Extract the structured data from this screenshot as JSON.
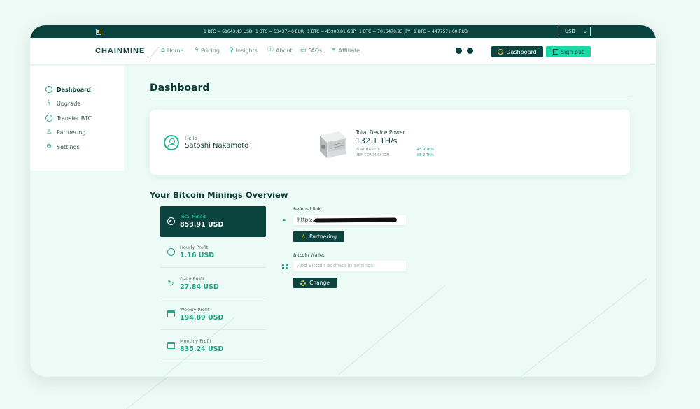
{
  "ticker": {
    "rates": [
      "1 BTC = 61643.43 USD",
      "1 BTC = 53437.46 EUR",
      "1 BTC = 45900.81 GBP",
      "1 BTC = 7016470.93 JPY",
      "1 BTC = 4477571.60 RUB"
    ],
    "currency": "USD"
  },
  "nav": {
    "brand": "CHAINMINE",
    "items": [
      {
        "label": "Home",
        "icon": "home-icon"
      },
      {
        "label": "Pricing",
        "icon": "bolt-icon"
      },
      {
        "label": "Insights",
        "icon": "insights-icon"
      },
      {
        "label": "About",
        "icon": "info-icon"
      },
      {
        "label": "FAQs",
        "icon": "faq-icon"
      },
      {
        "label": "Affiliate",
        "icon": "link-icon"
      }
    ],
    "dashboard_label": "Dashboard",
    "signout_label": "Sign out"
  },
  "sidebar": {
    "items": [
      {
        "label": "Dashboard",
        "icon": "user-circle-icon"
      },
      {
        "label": "Upgrade",
        "icon": "bolt-icon"
      },
      {
        "label": "Transfer BTC",
        "icon": "transfer-icon"
      },
      {
        "label": "Partnering",
        "icon": "user-icon"
      },
      {
        "label": "Settings",
        "icon": "gear-icon"
      }
    ]
  },
  "main": {
    "title": "Dashboard",
    "welcome": {
      "hello": "Hello",
      "name": "Satoshi Nakamoto"
    },
    "device": {
      "power_label": "Total Device Power",
      "power_value": "132.1 TH/s",
      "purchased_label": "PURCHASED",
      "purchased_value": "45.9 TH/s",
      "ref_label": "REF COMMISSION",
      "ref_value": "85.2 TH/s"
    },
    "overview_title": "Your Bitcoin Minings Overview",
    "stats": [
      {
        "label": "Total Mined",
        "value": "853.91 USD"
      },
      {
        "label": "Hourly Profit",
        "value": "1.16 USD"
      },
      {
        "label": "Daily Profit",
        "value": "27.84 USD"
      },
      {
        "label": "Weekly Profit",
        "value": "194.89 USD"
      },
      {
        "label": "Monthly Profit",
        "value": "835.24 USD"
      }
    ],
    "referral": {
      "label": "Referral link",
      "value": "https://",
      "button": "Partnering"
    },
    "wallet": {
      "label": "Bitcoin Wallet",
      "placeholder": "Add Bitcoin address in settings",
      "button": "Change"
    }
  },
  "colors": {
    "dark": "#0b443e",
    "accent": "#1bd9a6",
    "green_text": "#1ea384",
    "background": "#eefaf6"
  }
}
